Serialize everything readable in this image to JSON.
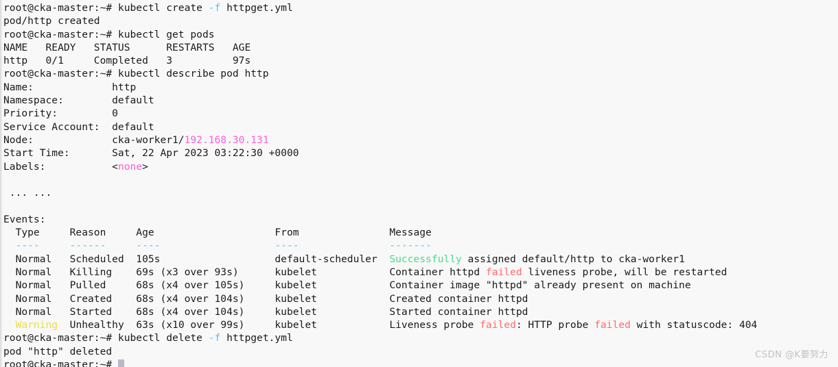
{
  "terminal": {
    "background_color": "#f8f8f8",
    "foreground_color": "#1a1a1a",
    "colors": {
      "cyan": "#4fc3f7",
      "green": "#4bdc8a",
      "red": "#ff6b6b",
      "yellow": "#e8e23a",
      "magenta": "#ff5fd7",
      "cursor": "#b9b9c6"
    },
    "prompt": "root@cka-master:~# ",
    "lines": [
      {
        "id": "l01",
        "segments": [
          {
            "text": "root@cka-master:~# kubectl create ",
            "color": "default"
          },
          {
            "text": "-f",
            "color": "cyan"
          },
          {
            "text": " httpget.yml",
            "color": "default"
          }
        ]
      },
      {
        "id": "l02",
        "segments": [
          {
            "text": "pod/http created",
            "color": "default"
          }
        ]
      },
      {
        "id": "l03",
        "segments": [
          {
            "text": "root@cka-master:~# kubectl get pods",
            "color": "default"
          }
        ]
      },
      {
        "id": "l04",
        "segments": [
          {
            "text": "NAME   READY   STATUS      RESTARTS   AGE",
            "color": "default"
          }
        ]
      },
      {
        "id": "l05",
        "segments": [
          {
            "text": "http   0/1     Completed   3          97s",
            "color": "default"
          }
        ]
      },
      {
        "id": "l06",
        "segments": [
          {
            "text": "root@cka-master:~# kubectl describe pod http",
            "color": "default"
          }
        ]
      },
      {
        "id": "l07",
        "segments": [
          {
            "text": "Name:             http",
            "color": "default"
          }
        ]
      },
      {
        "id": "l08",
        "segments": [
          {
            "text": "Namespace:        default",
            "color": "default"
          }
        ]
      },
      {
        "id": "l09",
        "segments": [
          {
            "text": "Priority:         0",
            "color": "default"
          }
        ]
      },
      {
        "id": "l10",
        "segments": [
          {
            "text": "Service Account:  default",
            "color": "default"
          }
        ]
      },
      {
        "id": "l11",
        "segments": [
          {
            "text": "Node:             cka-worker1/",
            "color": "default"
          },
          {
            "text": "192.168.30.131",
            "color": "magenta"
          }
        ]
      },
      {
        "id": "l12",
        "segments": [
          {
            "text": "Start Time:       Sat, 22 Apr 2023 03:22:30 +0000",
            "color": "default"
          }
        ]
      },
      {
        "id": "l13",
        "segments": [
          {
            "text": "Labels:           <",
            "color": "default"
          },
          {
            "text": "none",
            "color": "magenta"
          },
          {
            "text": ">",
            "color": "default"
          }
        ]
      },
      {
        "id": "l14",
        "segments": [
          {
            "text": "",
            "color": "default"
          }
        ]
      },
      {
        "id": "l15",
        "segments": [
          {
            "text": " ... ...",
            "color": "default"
          }
        ]
      },
      {
        "id": "l16",
        "segments": [
          {
            "text": "",
            "color": "default"
          }
        ]
      },
      {
        "id": "l17",
        "segments": [
          {
            "text": "Events:",
            "color": "default"
          }
        ]
      },
      {
        "id": "l18",
        "segments": [
          {
            "text": "  Type     Reason     Age                    From               Message",
            "color": "default"
          }
        ]
      },
      {
        "id": "l19",
        "segments": [
          {
            "text": "  ----     ------     ----                   ----               -------",
            "color": "cyan"
          }
        ]
      },
      {
        "id": "l20",
        "segments": [
          {
            "text": "  Normal   Scheduled  105s                   default-scheduler  ",
            "color": "default"
          },
          {
            "text": "Successfully",
            "color": "green"
          },
          {
            "text": " assigned default/http to cka-worker1",
            "color": "default"
          }
        ]
      },
      {
        "id": "l21",
        "segments": [
          {
            "text": "  Normal   Killing    69s (x3 over 93s)      kubelet            Container httpd ",
            "color": "default"
          },
          {
            "text": "failed",
            "color": "red"
          },
          {
            "text": " liveness probe, will be restarted",
            "color": "default"
          }
        ]
      },
      {
        "id": "l22",
        "segments": [
          {
            "text": "  Normal   Pulled     68s (x4 over 105s)     kubelet            Container image \"httpd\" already present on machine",
            "color": "default"
          }
        ]
      },
      {
        "id": "l23",
        "segments": [
          {
            "text": "  Normal   Created    68s (x4 over 104s)     kubelet            Created container httpd",
            "color": "default"
          }
        ]
      },
      {
        "id": "l24",
        "segments": [
          {
            "text": "  Normal   Started    68s (x4 over 104s)     kubelet            Started container httpd",
            "color": "default"
          }
        ]
      },
      {
        "id": "l25",
        "segments": [
          {
            "text": "  ",
            "color": "default"
          },
          {
            "text": "Warning",
            "color": "yellow"
          },
          {
            "text": "  Unhealthy  63s (x10 over 99s)     kubelet            Liveness probe ",
            "color": "default"
          },
          {
            "text": "failed",
            "color": "red"
          },
          {
            "text": ": HTTP probe ",
            "color": "default"
          },
          {
            "text": "failed",
            "color": "red"
          },
          {
            "text": " with statuscode: 404",
            "color": "default"
          }
        ]
      },
      {
        "id": "l26",
        "segments": [
          {
            "text": "root@cka-master:~# kubectl delete ",
            "color": "default"
          },
          {
            "text": "-f",
            "color": "cyan"
          },
          {
            "text": " httpget.yml",
            "color": "default"
          }
        ]
      },
      {
        "id": "l27",
        "segments": [
          {
            "text": "pod \"http\" deleted",
            "color": "default"
          }
        ]
      },
      {
        "id": "l28",
        "segments": [
          {
            "text": "root@cka-master:~# ",
            "color": "default"
          },
          {
            "cursor": true
          }
        ]
      }
    ]
  },
  "watermark": {
    "text": "CSDN @K要努力"
  }
}
